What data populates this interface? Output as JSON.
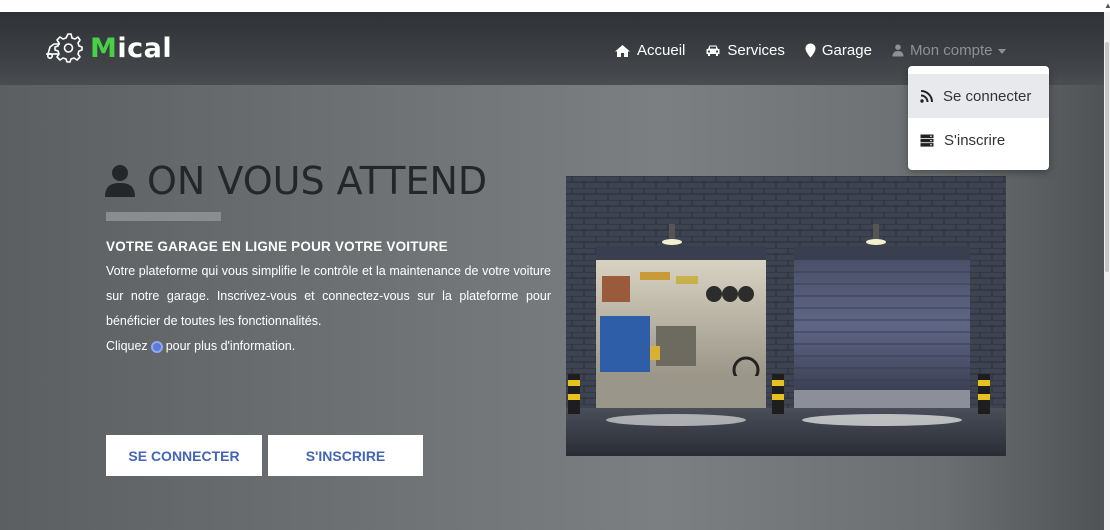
{
  "brand": {
    "accent_letter": "M",
    "rest": "ical",
    "accent_color": "#48d046"
  },
  "nav": {
    "home": "Accueil",
    "services": "Services",
    "garage": "Garage",
    "account": "Mon compte"
  },
  "dropdown": {
    "login": "Se connecter",
    "signup": "S'inscrire"
  },
  "hero": {
    "title": "ON VOUS ATTEND",
    "subtitle": "VOTRE GARAGE EN LIGNE POUR VOTRE VOITURE",
    "description": "Votre plateforme qui vous simplifie le contrôle et la maintenance de votre voiture sur notre garage. Inscrivez-vous et connectez-vous sur la plateforme pour bénéficier de toutes les fonctionnalités.",
    "click_before": "Cliquez",
    "click_after": "pour plus d'information."
  },
  "buttons": {
    "login": "SE CONNECTER",
    "signup": "S'INSCRIRE"
  },
  "icons": [
    "car-gear-logo-icon",
    "home-icon",
    "car-icon",
    "map-marker-icon",
    "user-icon",
    "rss-icon",
    "server-icon",
    "info-icon"
  ],
  "colors": {
    "navbar": "#35383c",
    "link_button_text": "#4365b5"
  }
}
